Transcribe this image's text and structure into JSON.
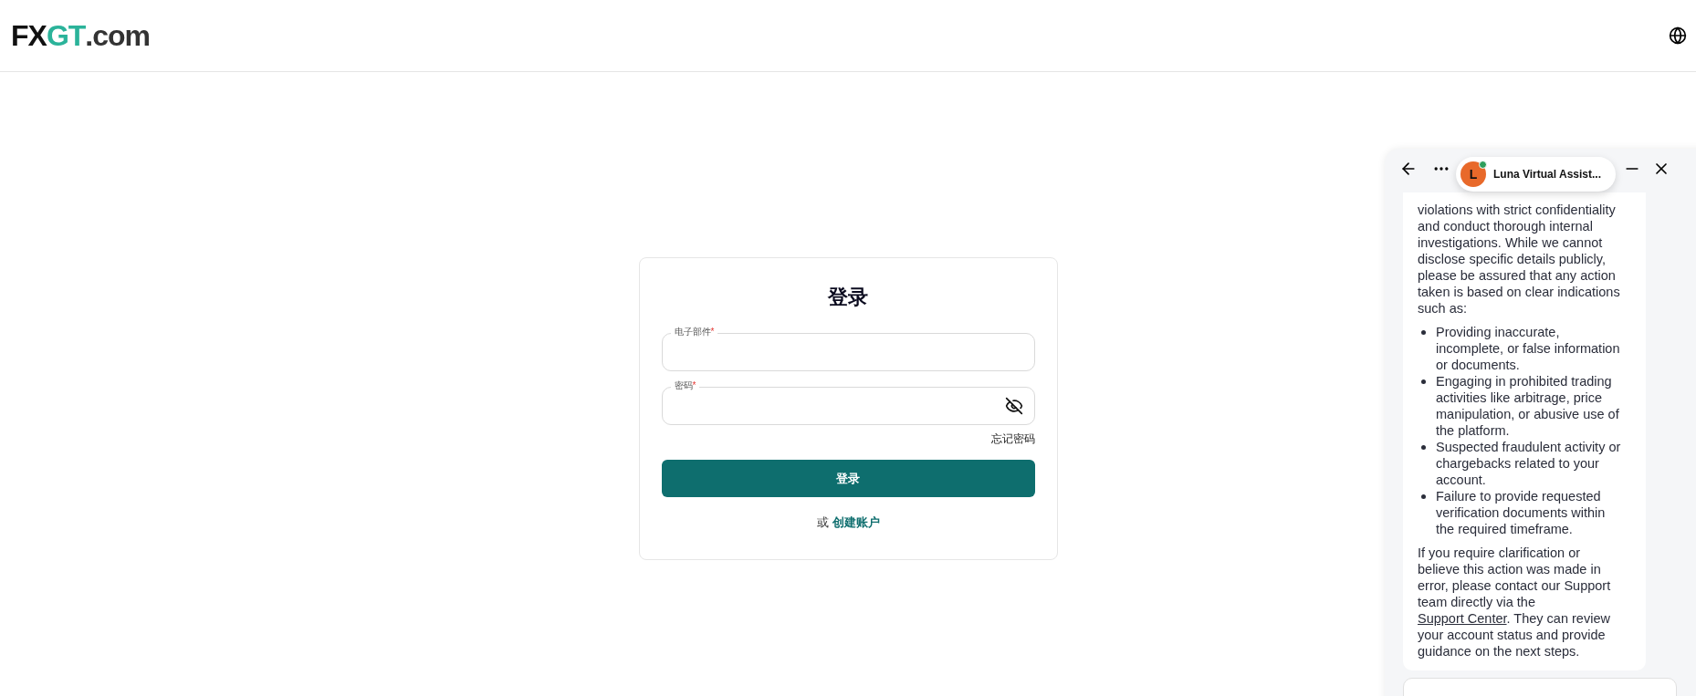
{
  "header": {
    "logo": {
      "parts": [
        {
          "text": "FX",
          "color": "#111111"
        },
        {
          "text": "GT",
          "color": "#2bb39a"
        },
        {
          "text": ".com",
          "color": "#333333"
        }
      ]
    }
  },
  "login": {
    "title": "登录",
    "fields": [
      {
        "label": "电子部件",
        "required_mark": "*",
        "kind": "text"
      },
      {
        "label": "密码",
        "required_mark": "*",
        "kind": "password"
      }
    ],
    "forgot_link": "忘记密码",
    "submit_button": "登录",
    "alt_text": "或",
    "create_link": "创建账户"
  },
  "chat": {
    "assistant_name": "Luna Virtual Assist...",
    "avatar_letter": "L",
    "online": true,
    "intro": "violations with strict confidentiality and conduct thorough internal investigations. While we cannot disclose specific details publicly, please be assured that any action taken is based on clear indications such as:",
    "bullets": [
      "Providing inaccurate, incomplete, or false information or documents.",
      "Engaging in prohibited trading activities like arbitrage, price manipulation, or abusive use of the platform.",
      "Suspected fraudulent activity or chargebacks related to your account.",
      "Failure to provide requested verification documents within the required timeframe."
    ],
    "closing_before": "If you require clarification or believe this action was made in error, please contact our Support team directly via the",
    "closing_link": "Support Center",
    "closing_after": ". They can review your account status and provide guidance on the next steps."
  }
}
